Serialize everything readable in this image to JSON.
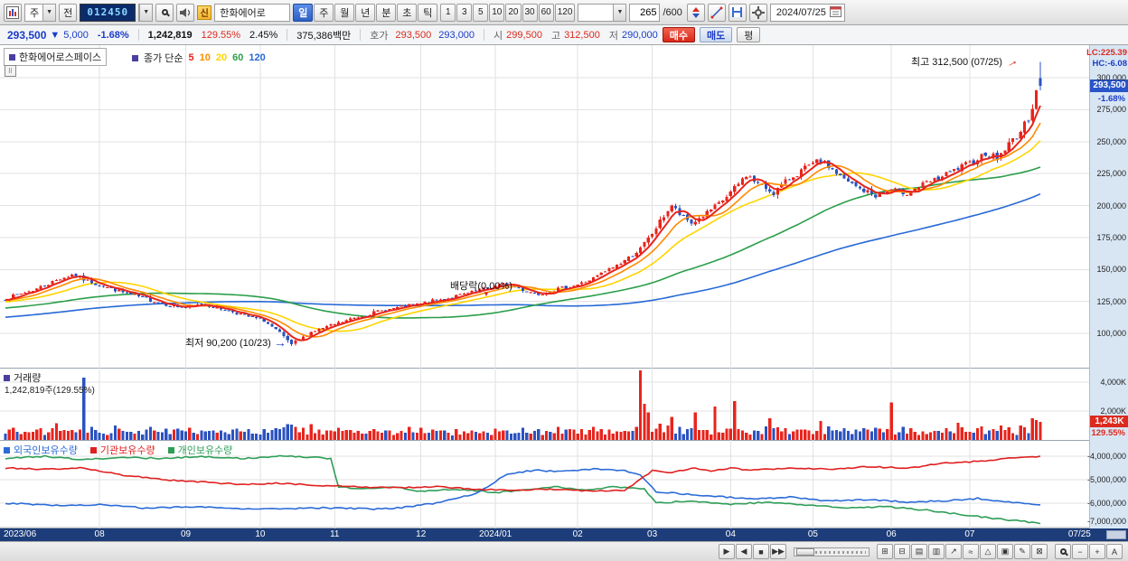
{
  "toolbar": {
    "period_select": "주",
    "jeon_button": "전",
    "stock_code": "012450",
    "new_badge": "신",
    "stock_name": "한화에어로",
    "period_tabs": [
      "일",
      "주",
      "월",
      "년",
      "분",
      "초",
      "틱"
    ],
    "active_period_index": 0,
    "interval_buttons": [
      "1",
      "3",
      "5",
      "10",
      "20",
      "30",
      "60",
      "120"
    ],
    "candle_count": "265",
    "candle_total": "/600",
    "date_value": "2024/07/25"
  },
  "quote": {
    "price": "293,500",
    "arrow": "▼",
    "change": "5,000",
    "change_pct": "-1.68%",
    "volume": "1,242,819",
    "volume_ratio": "129.55%",
    "turnover": "2.45%",
    "value": "375,386백만",
    "hoga_label": "호가",
    "ask": "293,500",
    "bid": "293,000",
    "open_label": "시",
    "open": "299,500",
    "high_label": "고",
    "high": "312,500",
    "low_label": "저",
    "low": "290,000",
    "buy": "매수",
    "sell": "매도",
    "avg": "평"
  },
  "price_pane": {
    "title": "한화에어로스페이스",
    "legend_prefix": "종가 단순",
    "ma": [
      {
        "period": "5",
        "color": "#e8241c"
      },
      {
        "period": "10",
        "color": "#ff8a00"
      },
      {
        "period": "20",
        "color": "#ffd400"
      },
      {
        "period": "60",
        "color": "#2b9e4a"
      },
      {
        "period": "120",
        "color": "#2769d6"
      }
    ],
    "lc": "LC:225.39",
    "hc": "HC:-6.08",
    "high_annotation": "최고 312,500 (07/25)",
    "low_annotation": "최저 90,200 (10/23)",
    "dividend_annotation": "배당락(0.00%)",
    "price_badge": "293,500",
    "price_badge_pct": "-1.68%",
    "axis_labels": [
      "300,000",
      "275,000",
      "250,000",
      "225,000",
      "200,000",
      "175,000",
      "150,000",
      "125,000",
      "100,000"
    ]
  },
  "volume_pane": {
    "title": "거래량",
    "subtitle": "1,242,819주(129.55%)",
    "axis_labels": [
      "4,000K",
      "2,000K"
    ],
    "badge": "1,243K",
    "badge_pct": "129.55%"
  },
  "holdings_pane": {
    "legend": [
      {
        "label": "외국인보유수량",
        "color": "#2b6bd8"
      },
      {
        "label": "기관보유수량",
        "color": "#e02020"
      },
      {
        "label": "개인보유수량",
        "color": "#2e9e57"
      }
    ],
    "axis_labels": [
      "-4,000,000",
      "-5,000,000",
      "-6,000,000",
      "-7,000,000"
    ]
  },
  "bottom_bar": {
    "scroll_buttons": [
      {
        "name": "chart-play-button",
        "glyph": "▶"
      },
      {
        "name": "chart-back-button",
        "glyph": "◀"
      },
      {
        "name": "chart-stop-button",
        "glyph": "■"
      },
      {
        "name": "chart-forward-button",
        "glyph": "▶▶"
      }
    ],
    "tools": [
      {
        "name": "grid-tool-icon",
        "glyph": "⊞"
      },
      {
        "name": "layout-tool-icon",
        "glyph": "⊟"
      },
      {
        "name": "list-tool-icon",
        "glyph": "▤"
      },
      {
        "name": "panel-tool-icon",
        "glyph": "▥"
      },
      {
        "name": "trendline-tool-icon",
        "glyph": "↗"
      },
      {
        "name": "wave-tool-icon",
        "glyph": "≈"
      },
      {
        "name": "shape-tool-icon",
        "glyph": "△"
      },
      {
        "name": "box-tool-icon",
        "glyph": "▣"
      },
      {
        "name": "draw-tool-icon",
        "glyph": "✎"
      },
      {
        "name": "erase-tool-icon",
        "glyph": "⊠"
      }
    ],
    "zoom_out": "−",
    "zoom_in": "+",
    "font_label": "A"
  },
  "chart_data": {
    "type": "candlestick",
    "symbol": "012450",
    "candle_count": 265,
    "price_gridlines": [
      300000,
      275000,
      250000,
      225000,
      200000,
      175000,
      150000,
      125000,
      100000
    ],
    "volume_gridlines_k": [
      4000,
      2000
    ],
    "holdings_gridlines_m": [
      -4,
      -5,
      -6,
      -7
    ],
    "month_ticks": [
      [
        0,
        "2023/06"
      ],
      [
        24,
        "08"
      ],
      [
        46,
        "09"
      ],
      [
        65,
        "10"
      ],
      [
        84,
        "11"
      ],
      [
        106,
        "12"
      ],
      [
        125,
        "2024/01"
      ],
      [
        146,
        "02"
      ],
      [
        165,
        "03"
      ],
      [
        185,
        "04"
      ],
      [
        206,
        "05"
      ],
      [
        226,
        "06"
      ],
      [
        246,
        "07"
      ],
      [
        274,
        "07/25"
      ]
    ],
    "close_keypoints": [
      [
        0,
        127000
      ],
      [
        8,
        135000
      ],
      [
        14,
        143000
      ],
      [
        17,
        146000
      ],
      [
        20,
        142000
      ],
      [
        26,
        136000
      ],
      [
        30,
        132000
      ],
      [
        36,
        127000
      ],
      [
        42,
        122000
      ],
      [
        46,
        120000
      ],
      [
        50,
        123000
      ],
      [
        54,
        120000
      ],
      [
        58,
        117000
      ],
      [
        62,
        113000
      ],
      [
        66,
        110000
      ],
      [
        70,
        100000
      ],
      [
        73,
        91500
      ],
      [
        75,
        95000
      ],
      [
        78,
        101000
      ],
      [
        82,
        105000
      ],
      [
        86,
        109000
      ],
      [
        90,
        113000
      ],
      [
        95,
        117000
      ],
      [
        100,
        120000
      ],
      [
        106,
        123000
      ],
      [
        112,
        127000
      ],
      [
        118,
        131000
      ],
      [
        124,
        136000
      ],
      [
        128,
        139000
      ],
      [
        132,
        134000
      ],
      [
        136,
        131000
      ],
      [
        140,
        134000
      ],
      [
        146,
        138000
      ],
      [
        150,
        143000
      ],
      [
        154,
        150000
      ],
      [
        158,
        157000
      ],
      [
        162,
        166000
      ],
      [
        165,
        178000
      ],
      [
        168,
        192000
      ],
      [
        170,
        200000
      ],
      [
        172,
        193000
      ],
      [
        175,
        186000
      ],
      [
        178,
        192000
      ],
      [
        182,
        201000
      ],
      [
        186,
        213000
      ],
      [
        189,
        224000
      ],
      [
        192,
        217000
      ],
      [
        196,
        210000
      ],
      [
        200,
        221000
      ],
      [
        204,
        229000
      ],
      [
        208,
        235000
      ],
      [
        211,
        228000
      ],
      [
        214,
        220000
      ],
      [
        218,
        213000
      ],
      [
        222,
        208000
      ],
      [
        226,
        212000
      ],
      [
        230,
        210000
      ],
      [
        234,
        216000
      ],
      [
        238,
        221000
      ],
      [
        242,
        227000
      ],
      [
        246,
        233000
      ],
      [
        250,
        241000
      ],
      [
        253,
        237000
      ],
      [
        256,
        248000
      ],
      [
        259,
        258000
      ],
      [
        261,
        268000
      ],
      [
        262,
        278000
      ],
      [
        263,
        291000
      ],
      [
        264,
        293500
      ]
    ],
    "low_point": {
      "index": 73,
      "price": 90200
    },
    "last_candle": {
      "open": 299500,
      "high": 312500,
      "low": 290000,
      "close": 293500
    },
    "prehistory": {
      "start": 98000,
      "end": 127000
    },
    "volume_spikes_k": [
      [
        13,
        1150,
        "u"
      ],
      [
        20,
        4300,
        "d"
      ],
      [
        74,
        900,
        "u"
      ],
      [
        106,
        850,
        "u"
      ],
      [
        150,
        900,
        "u"
      ],
      [
        162,
        4800,
        "u"
      ],
      [
        163,
        2500,
        "u"
      ],
      [
        164,
        1900,
        "u"
      ],
      [
        170,
        1600,
        "u"
      ],
      [
        176,
        1900,
        "u"
      ],
      [
        181,
        2300,
        "u"
      ],
      [
        186,
        2700,
        "u"
      ],
      [
        195,
        1500,
        "u"
      ],
      [
        208,
        1300,
        "u"
      ],
      [
        226,
        2600,
        "u"
      ],
      [
        243,
        1200,
        "u"
      ],
      [
        259,
        1000,
        "u"
      ],
      [
        262,
        1500,
        "u"
      ],
      [
        264,
        1243,
        "u"
      ]
    ],
    "holdings_series": {
      "foreign": [
        [
          0,
          -6.0
        ],
        [
          15,
          -6.1
        ],
        [
          25,
          -6.05
        ],
        [
          35,
          -6.2
        ],
        [
          50,
          -6.15
        ],
        [
          65,
          -6.25
        ],
        [
          80,
          -6.2
        ],
        [
          95,
          -6.25
        ],
        [
          100,
          -6.2
        ],
        [
          110,
          -6.0
        ],
        [
          120,
          -5.6
        ],
        [
          128,
          -4.75
        ],
        [
          135,
          -4.6
        ],
        [
          142,
          -4.65
        ],
        [
          150,
          -4.55
        ],
        [
          158,
          -4.6
        ],
        [
          162,
          -4.8
        ],
        [
          166,
          -5.5
        ],
        [
          172,
          -5.6
        ],
        [
          180,
          -5.7
        ],
        [
          190,
          -5.8
        ],
        [
          200,
          -5.75
        ],
        [
          210,
          -5.9
        ],
        [
          220,
          -5.85
        ],
        [
          230,
          -5.95
        ],
        [
          240,
          -5.9
        ],
        [
          248,
          -5.8
        ],
        [
          255,
          -5.95
        ],
        [
          264,
          -6.05
        ]
      ],
      "institution": [
        [
          0,
          -4.5
        ],
        [
          10,
          -4.55
        ],
        [
          20,
          -4.5
        ],
        [
          30,
          -4.8
        ],
        [
          40,
          -5.0
        ],
        [
          50,
          -5.1
        ],
        [
          60,
          -5.2
        ],
        [
          70,
          -5.15
        ],
        [
          80,
          -5.25
        ],
        [
          90,
          -5.3
        ],
        [
          100,
          -5.35
        ],
        [
          110,
          -5.3
        ],
        [
          120,
          -5.4
        ],
        [
          130,
          -5.45
        ],
        [
          140,
          -5.4
        ],
        [
          150,
          -5.5
        ],
        [
          158,
          -5.45
        ],
        [
          162,
          -5.0
        ],
        [
          165,
          -4.6
        ],
        [
          170,
          -4.7
        ],
        [
          175,
          -4.5
        ],
        [
          180,
          -4.65
        ],
        [
          185,
          -4.5
        ],
        [
          190,
          -4.6
        ],
        [
          200,
          -4.5
        ],
        [
          210,
          -4.55
        ],
        [
          220,
          -4.45
        ],
        [
          230,
          -4.5
        ],
        [
          240,
          -4.3
        ],
        [
          250,
          -4.2
        ],
        [
          258,
          -4.05
        ],
        [
          264,
          -4.0
        ]
      ],
      "individual": [
        [
          0,
          -4.1
        ],
        [
          10,
          -4.0
        ],
        [
          20,
          -4.15
        ],
        [
          30,
          -4.05
        ],
        [
          40,
          -4.1
        ],
        [
          50,
          -4.0
        ],
        [
          60,
          -4.1
        ],
        [
          70,
          -4.0
        ],
        [
          80,
          -4.05
        ],
        [
          83,
          -4.1
        ],
        [
          85,
          -5.3
        ],
        [
          90,
          -5.4
        ],
        [
          100,
          -5.3
        ],
        [
          105,
          -5.5
        ],
        [
          115,
          -5.4
        ],
        [
          125,
          -5.55
        ],
        [
          135,
          -5.4
        ],
        [
          140,
          -5.3
        ],
        [
          148,
          -5.45
        ],
        [
          155,
          -5.3
        ],
        [
          163,
          -5.4
        ],
        [
          166,
          -6.0
        ],
        [
          175,
          -5.9
        ],
        [
          185,
          -6.05
        ],
        [
          195,
          -5.95
        ],
        [
          205,
          -6.1
        ],
        [
          215,
          -6.2
        ],
        [
          225,
          -6.15
        ],
        [
          235,
          -6.3
        ],
        [
          245,
          -6.5
        ],
        [
          255,
          -6.7
        ],
        [
          264,
          -6.85
        ]
      ]
    }
  }
}
